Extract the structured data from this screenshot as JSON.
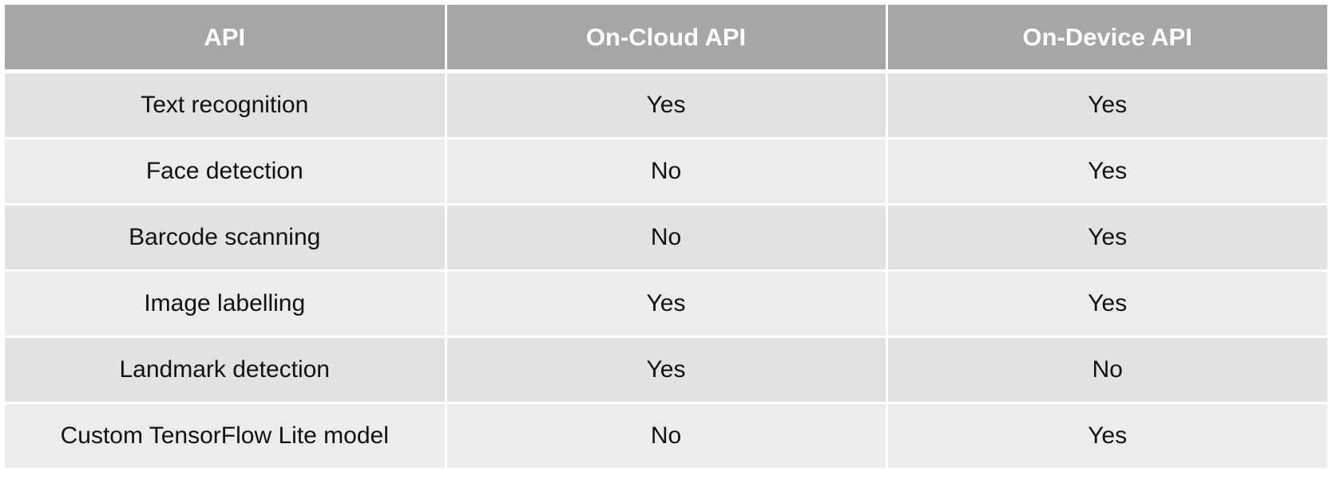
{
  "table": {
    "headers": [
      "API",
      "On-Cloud API",
      "On-Device API"
    ],
    "rows": [
      [
        "Text recognition",
        "Yes",
        "Yes"
      ],
      [
        "Face detection",
        "No",
        "Yes"
      ],
      [
        "Barcode scanning",
        "No",
        "Yes"
      ],
      [
        "Image labelling",
        "Yes",
        "Yes"
      ],
      [
        "Landmark detection",
        "Yes",
        "No"
      ],
      [
        "Custom TensorFlow Lite model",
        "No",
        "Yes"
      ]
    ]
  },
  "colors": {
    "header_bg": "#a6a6a6",
    "header_text": "#ffffff",
    "row_bg_odd": "#e2e2e2",
    "row_bg_even": "#ececec",
    "cell_text": "#111111"
  }
}
